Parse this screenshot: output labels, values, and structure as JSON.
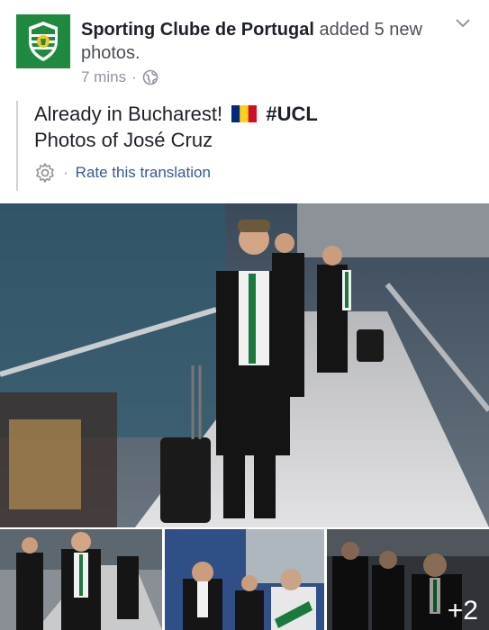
{
  "post": {
    "page_name": "Sporting Clube de Portugal",
    "action": "added 5 new photos.",
    "time": "7 mins",
    "visibility_icon": "globe-icon",
    "text_line1_prefix": "Already in Bucharest!",
    "flag": "romania-flag-emoji",
    "hashtag": "#UCL",
    "text_line2": "Photos of José Cruz",
    "translation_link": "Rate this translation",
    "more_photos_count": "+2"
  },
  "colors": {
    "brand_green": "#1f8a3f",
    "link_blue": "#365899",
    "meta_gray": "#90949c"
  }
}
